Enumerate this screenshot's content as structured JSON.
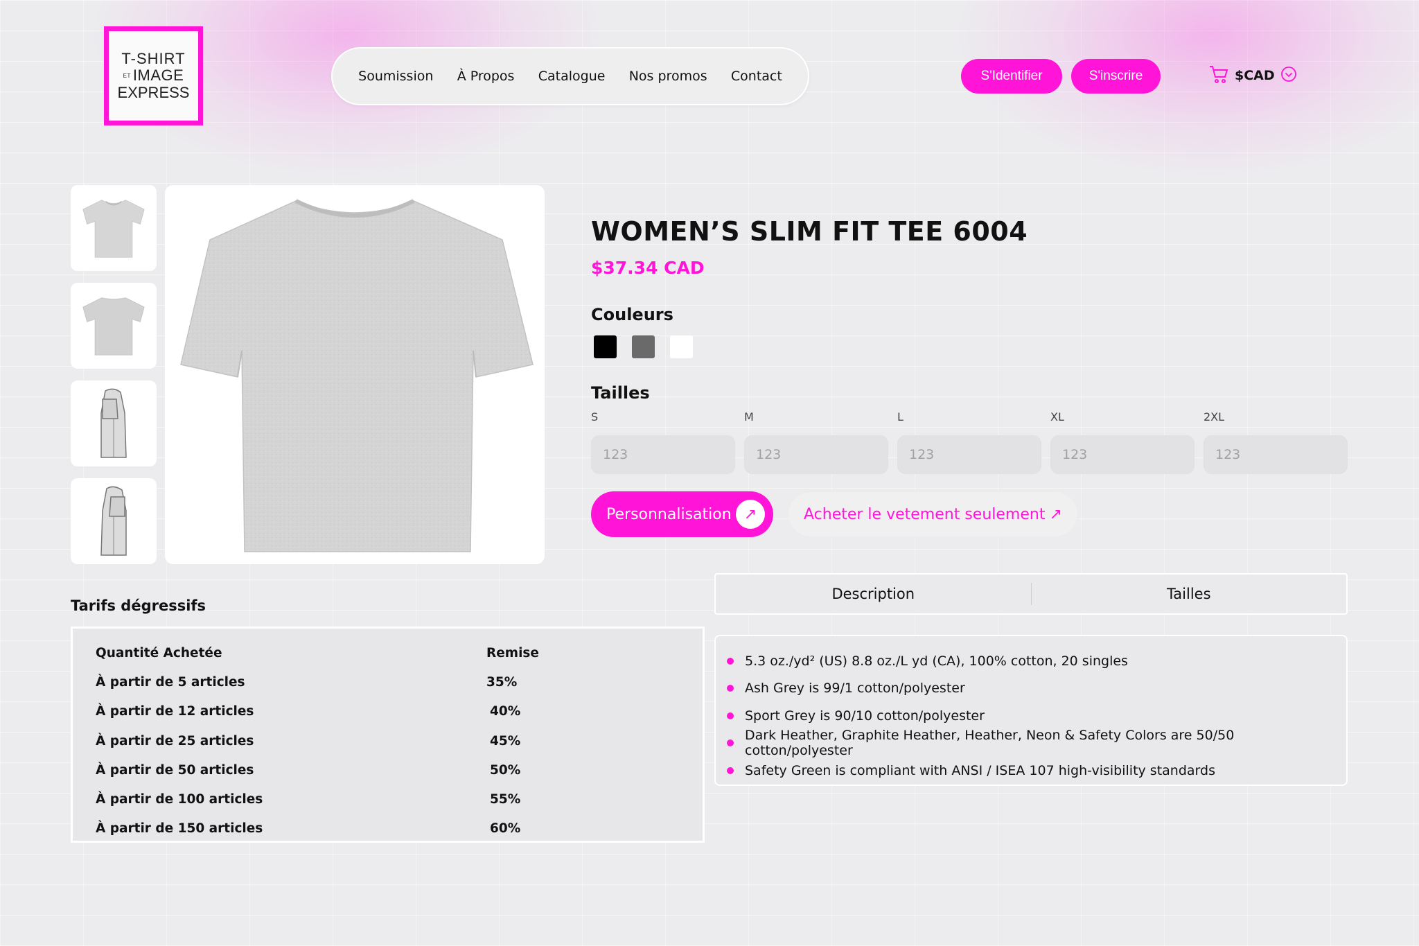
{
  "brand": {
    "logo_line1": "T-SHIRT",
    "logo_line2_small": "ET",
    "logo_line2": "IMAGE",
    "logo_line3": "EXPRESS",
    "accent_color": "#ff14d8"
  },
  "nav": {
    "items": [
      {
        "label": "Soumission"
      },
      {
        "label": "À Propos"
      },
      {
        "label": "Catalogue"
      },
      {
        "label": "Nos promos"
      },
      {
        "label": "Contact"
      }
    ]
  },
  "header": {
    "login_label": "S'Identifier",
    "signup_label": "S'inscrire",
    "currency": "$CAD",
    "cart_icon": "cart-icon",
    "currency_dropdown_icon": "chevron-down-circle-icon"
  },
  "product": {
    "title": "WOMEN’S SLIM FIT TEE 6004",
    "price": "$37.34 CAD",
    "colors_label": "Couleurs",
    "colors": [
      "#000000",
      "#6a6a6a",
      "#ffffff"
    ],
    "sizes_label": "Tailles",
    "sizes": [
      {
        "label": "S",
        "placeholder": "123"
      },
      {
        "label": "M",
        "placeholder": "123"
      },
      {
        "label": "L",
        "placeholder": "123"
      },
      {
        "label": "XL",
        "placeholder": "123"
      },
      {
        "label": "2XL",
        "placeholder": "123"
      }
    ],
    "personalize_label": "Personnalisation",
    "buy_label": "Acheter le vetement seulement"
  },
  "tabs": [
    {
      "label": "Description"
    },
    {
      "label": "Tailles"
    }
  ],
  "description": [
    "5.3 oz./yd² (US) 8.8 oz./L yd (CA), 100% cotton, 20 singles",
    "Ash Grey is 99/1 cotton/polyester",
    "Sport Grey is 90/10 cotton/polyester",
    "Dark Heather, Graphite Heather, Heather, Neon & Safety Colors are 50/50 cotton/polyester",
    "Safety Green is compliant with ANSI / ISEA 107 high-visibility standards"
  ],
  "pricing": {
    "title": "Tarifs dégressifs",
    "headers": [
      "Quantité Achetée",
      "Remise"
    ],
    "rows": [
      [
        "À partir de 5 articles",
        "35%"
      ],
      [
        "À partir de 12 articles",
        "40%"
      ],
      [
        "À partir de 25 articles",
        "45%"
      ],
      [
        "À partir de 50 articles",
        "50%"
      ],
      [
        "À partir de 100 articles",
        "55%"
      ],
      [
        "À partir de 150 articles",
        "60%"
      ]
    ]
  }
}
